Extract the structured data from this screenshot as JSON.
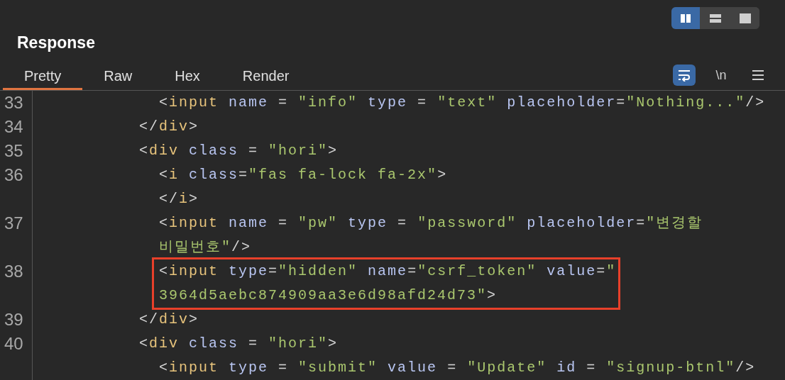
{
  "panel": {
    "title": "Response"
  },
  "layout_toggles": [
    {
      "kind": "split",
      "selected": true
    },
    {
      "kind": "stacked",
      "selected": false
    },
    {
      "kind": "single",
      "selected": false
    }
  ],
  "tabs": [
    {
      "label": "Pretty",
      "selected": true
    },
    {
      "label": "Raw",
      "selected": false
    },
    {
      "label": "Hex",
      "selected": false
    },
    {
      "label": "Render",
      "selected": false
    }
  ],
  "view_options": [
    {
      "kind": "wrap",
      "selected": true
    },
    {
      "kind": "text",
      "label": "\\n",
      "selected": false
    },
    {
      "kind": "menu",
      "selected": false
    }
  ],
  "code_lines": [
    {
      "number": "33",
      "highlighted": false,
      "rows": [
        "            <input name = \"info\" type = \"text\" placeholder=\"Nothing...\"/>"
      ]
    },
    {
      "number": "34",
      "highlighted": false,
      "rows": [
        "          </div>"
      ]
    },
    {
      "number": "35",
      "highlighted": false,
      "rows": [
        "          <div class = \"hori\">"
      ]
    },
    {
      "number": "36",
      "highlighted": false,
      "rows": [
        "            <i class=\"fas fa-lock fa-2x\">",
        "            </i>"
      ]
    },
    {
      "number": "37",
      "highlighted": false,
      "rows": [
        "            <input name = \"pw\" type = \"password\" placeholder=\"변경할",
        "            비밀번호\"/>"
      ]
    },
    {
      "number": "38",
      "highlighted": true,
      "rows": [
        "            <input type=\"hidden\" name=\"csrf_token\" value=\"",
        "            3964d5aebc874909aa3e6d98afd24d73\">"
      ]
    },
    {
      "number": "39",
      "highlighted": false,
      "rows": [
        "          </div>"
      ]
    },
    {
      "number": "40",
      "highlighted": false,
      "rows": [
        "          <div class = \"hori\">"
      ]
    },
    {
      "highlighted": false,
      "rows": [
        "            <input type = \"submit\" value = \"Update\" id = \"signup-btnl\"/>"
      ]
    }
  ]
}
